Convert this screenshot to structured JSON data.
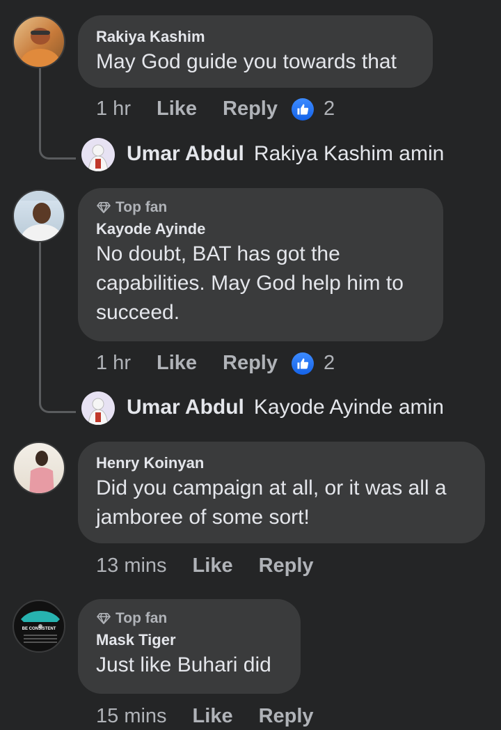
{
  "comments": [
    {
      "author": "Rakiya Kashim",
      "text": "May God guide you towards that",
      "time": "1 hr",
      "like_label": "Like",
      "reply_label": "Reply",
      "reactions": "2",
      "reply": {
        "author": "Umar Abdul",
        "text": "Rakiya Kashim amin"
      }
    },
    {
      "badge": "Top fan",
      "author": "Kayode Ayinde",
      "text_lines": [
        "No doubt, BAT has got the",
        "capabilities. May God help him to",
        "succeed."
      ],
      "time": "1 hr",
      "like_label": "Like",
      "reply_label": "Reply",
      "reactions": "2",
      "reply": {
        "author": "Umar Abdul",
        "text": "Kayode Ayinde amin"
      }
    },
    {
      "author": "Henry Koinyan",
      "text_lines": [
        "Did you campaign at all, or it was all a",
        "jamboree of some sort!"
      ],
      "time": "13 mins",
      "like_label": "Like",
      "reply_label": "Reply"
    },
    {
      "badge": "Top fan",
      "author": "Mask Tiger",
      "text": "Just like Buhari did",
      "time": "15 mins",
      "like_label": "Like",
      "reply_label": "Reply",
      "avatar_text": "BE CONSISTENT"
    }
  ],
  "colors": {
    "background": "#242526",
    "bubble": "#3a3b3c",
    "like_blue": "#1877f2",
    "meta": "#b0b3b8"
  }
}
